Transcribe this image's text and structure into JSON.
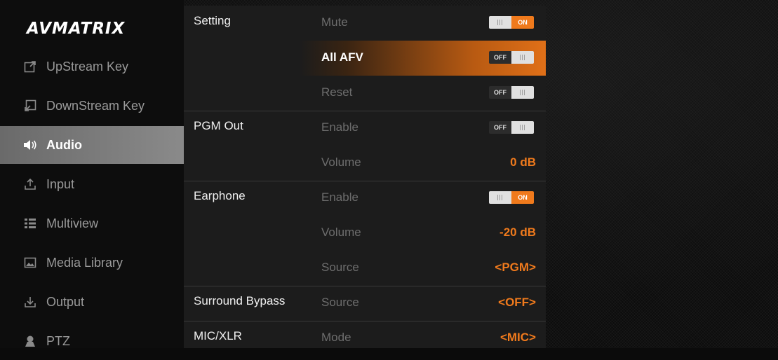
{
  "brand": {
    "logo": "AVMATRIX"
  },
  "sidebar": {
    "items": [
      {
        "label": "UpStream Key",
        "icon": "external-link-icon",
        "active": false
      },
      {
        "label": "DownStream Key",
        "icon": "import-icon",
        "active": false
      },
      {
        "label": "Audio",
        "icon": "speaker-icon",
        "active": true
      },
      {
        "label": "Input",
        "icon": "upload-icon",
        "active": false
      },
      {
        "label": "Multiview",
        "icon": "list-grid-icon",
        "active": false
      },
      {
        "label": "Media Library",
        "icon": "image-icon",
        "active": false
      },
      {
        "label": "Output",
        "icon": "download-icon",
        "active": false
      },
      {
        "label": "PTZ",
        "icon": "camera-icon",
        "active": false
      }
    ]
  },
  "panel": {
    "rows": [
      {
        "group": "Setting",
        "label": "Mute",
        "type": "toggle",
        "state": "ON",
        "highlight": false
      },
      {
        "group": "",
        "label": "All AFV",
        "type": "toggle",
        "state": "OFF",
        "highlight": true
      },
      {
        "group": "",
        "label": "Reset",
        "type": "toggle",
        "state": "OFF",
        "highlight": false
      },
      {
        "group": "PGM Out",
        "label": "Enable",
        "type": "toggle",
        "state": "OFF",
        "highlight": false
      },
      {
        "group": "",
        "label": "Volume",
        "type": "value",
        "value": "0 dB",
        "highlight": false
      },
      {
        "group": "Earphone",
        "label": "Enable",
        "type": "toggle",
        "state": "ON",
        "highlight": false
      },
      {
        "group": "",
        "label": "Volume",
        "type": "value",
        "value": "-20 dB",
        "highlight": false
      },
      {
        "group": "",
        "label": "Source",
        "type": "value",
        "value": "<PGM>",
        "highlight": false
      },
      {
        "group": "Surround Bypass",
        "label": "Source",
        "type": "value",
        "value": "<OFF>",
        "highlight": false
      },
      {
        "group": "MIC/XLR",
        "label": "Mode",
        "type": "value",
        "value": "<MIC>",
        "highlight": false
      }
    ]
  },
  "colors": {
    "accent": "#f07a1c",
    "active_nav": "#7a7a7a"
  }
}
